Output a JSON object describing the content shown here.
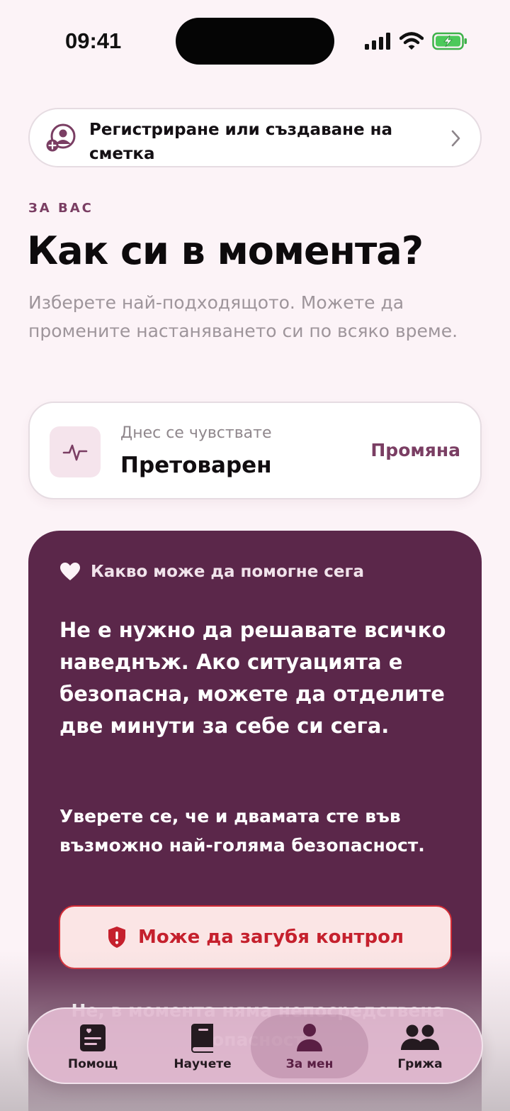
{
  "status_bar": {
    "time": "09:41"
  },
  "login": {
    "label": "Регистриране или създаване на сметка"
  },
  "section_label": "ЗА ВАС",
  "title": "Как си в момента?",
  "subtitle": "Изберете най-подходящото. Можете да промените настаняването си по всяко време.",
  "mood": {
    "caption": "Днес се чувствате",
    "value": "Претоварен",
    "change_label": "Промяна"
  },
  "help": {
    "heading": "Какво може да помогне сега",
    "main_text": "Не е нужно да решавате всичко наведнъж. Ако ситуацията е безопасна, можете да отделите две минути за себе си сега.",
    "secondary_text": "Уверете се, че и двамата сте във възможно най-голяма безопасност.",
    "risk_button_label": "Може да загубя контрол",
    "partial_text": "Не, в момента няма непосредствена опасност"
  },
  "tabs": [
    {
      "label": "Помощ",
      "icon": "journal-icon",
      "active": false
    },
    {
      "label": "Научете",
      "icon": "book-icon",
      "active": false
    },
    {
      "label": "За мен",
      "icon": "person-icon",
      "active": true
    },
    {
      "label": "Грижа",
      "icon": "people-icon",
      "active": false
    }
  ],
  "colors": {
    "accent": "#7a3e63",
    "card_dark": "#5b274a",
    "danger": "#c5202d",
    "background": "#fcf3f7"
  }
}
